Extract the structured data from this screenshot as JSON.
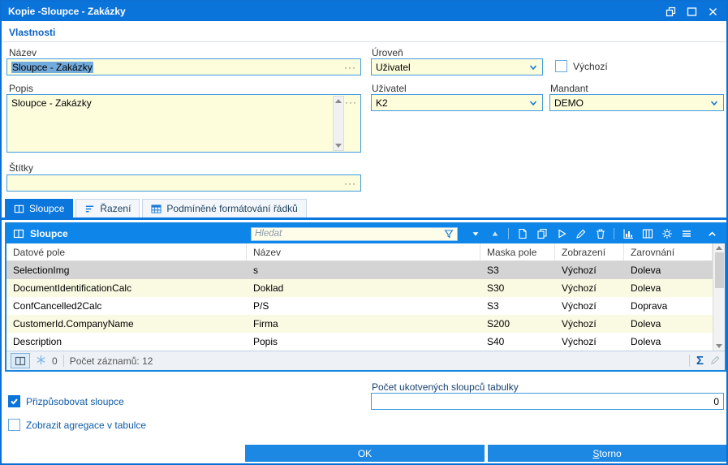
{
  "window": {
    "title": "Kopie -Sloupce - Zakázky",
    "controls": [
      "dock",
      "maximize",
      "close"
    ]
  },
  "properties": {
    "section_title": "Vlastnosti",
    "ellipsis": "···",
    "nazev": {
      "label": "Název",
      "value": "Sloupce - Zakázky"
    },
    "uroven": {
      "label": "Úroveň",
      "value": "Uživatel"
    },
    "vychozi": {
      "label": "Výchozí",
      "checked": false
    },
    "popis": {
      "label": "Popis",
      "value": "Sloupce - Zakázky"
    },
    "uzivatel": {
      "label": "Uživatel",
      "value": "K2"
    },
    "mandant": {
      "label": "Mandant",
      "value": "DEMO"
    },
    "stitky": {
      "label": "Štítky",
      "value": ""
    }
  },
  "tabs": [
    {
      "label": "Sloupce",
      "active": true,
      "icon": "columns-icon"
    },
    {
      "label": "Řazení",
      "active": false,
      "icon": "sort-icon"
    },
    {
      "label": "Podmíněné formátování řádků",
      "active": false,
      "icon": "grid-format-icon"
    }
  ],
  "table": {
    "caption": "Sloupce",
    "caption_icon": "columns-icon",
    "search_placeholder": "Hledat",
    "toolbar_icons": [
      "filter-icon",
      "filter-dropdown-icon",
      "sort-up-icon",
      "new-record-icon",
      "copy-record-icon",
      "run-icon",
      "edit-icon",
      "delete-icon",
      "chart-icon",
      "column-settings-icon",
      "settings-icon",
      "menu-icon",
      "collapse-icon"
    ],
    "columns": [
      "Datové pole",
      "Název",
      "Maska pole",
      "Zobrazení",
      "Zarovnání"
    ],
    "rows": [
      [
        "SelectionImg",
        "s",
        "S3",
        "Výchozí",
        "Doleva"
      ],
      [
        "DocumentIdentificationCalc",
        "Doklad",
        "S30",
        "Výchozí",
        "Doleva"
      ],
      [
        "ConfCancelled2Calc",
        "P/S",
        "S3",
        "Výchozí",
        "Doprava"
      ],
      [
        "CustomerId.CompanyName",
        "Firma",
        "S200",
        "Výchozí",
        "Doleva"
      ],
      [
        "Description",
        "Popis",
        "S40",
        "Výchozí",
        "Doleva"
      ]
    ],
    "selected_row_index": 0,
    "status": {
      "flag_count": "0",
      "records_label": "Počet záznamů: 12",
      "sum_symbol": "Σ",
      "icons": [
        "book-icon",
        "snowflake-icon",
        "sum-icon",
        "edit-disabled-icon"
      ]
    }
  },
  "footer": {
    "fit_columns": {
      "label": "Přizpůsobovat sloupce",
      "checked": true
    },
    "show_aggregations": {
      "label": "Zobrazit agregace v tabulce",
      "checked": false
    },
    "pinned_columns": {
      "label": "Počet ukotvených sloupců tabulky",
      "value": "0"
    }
  },
  "buttons": {
    "ok": "OK",
    "storno": "Storno"
  },
  "colors": {
    "titlebar": "#0b74da",
    "panel_accent": "#0e85e9",
    "field_bg": "#fdfddc",
    "text_selection": "#74abdd",
    "selected_row": "#d4d4d4",
    "alt_row": "#fafae3"
  }
}
